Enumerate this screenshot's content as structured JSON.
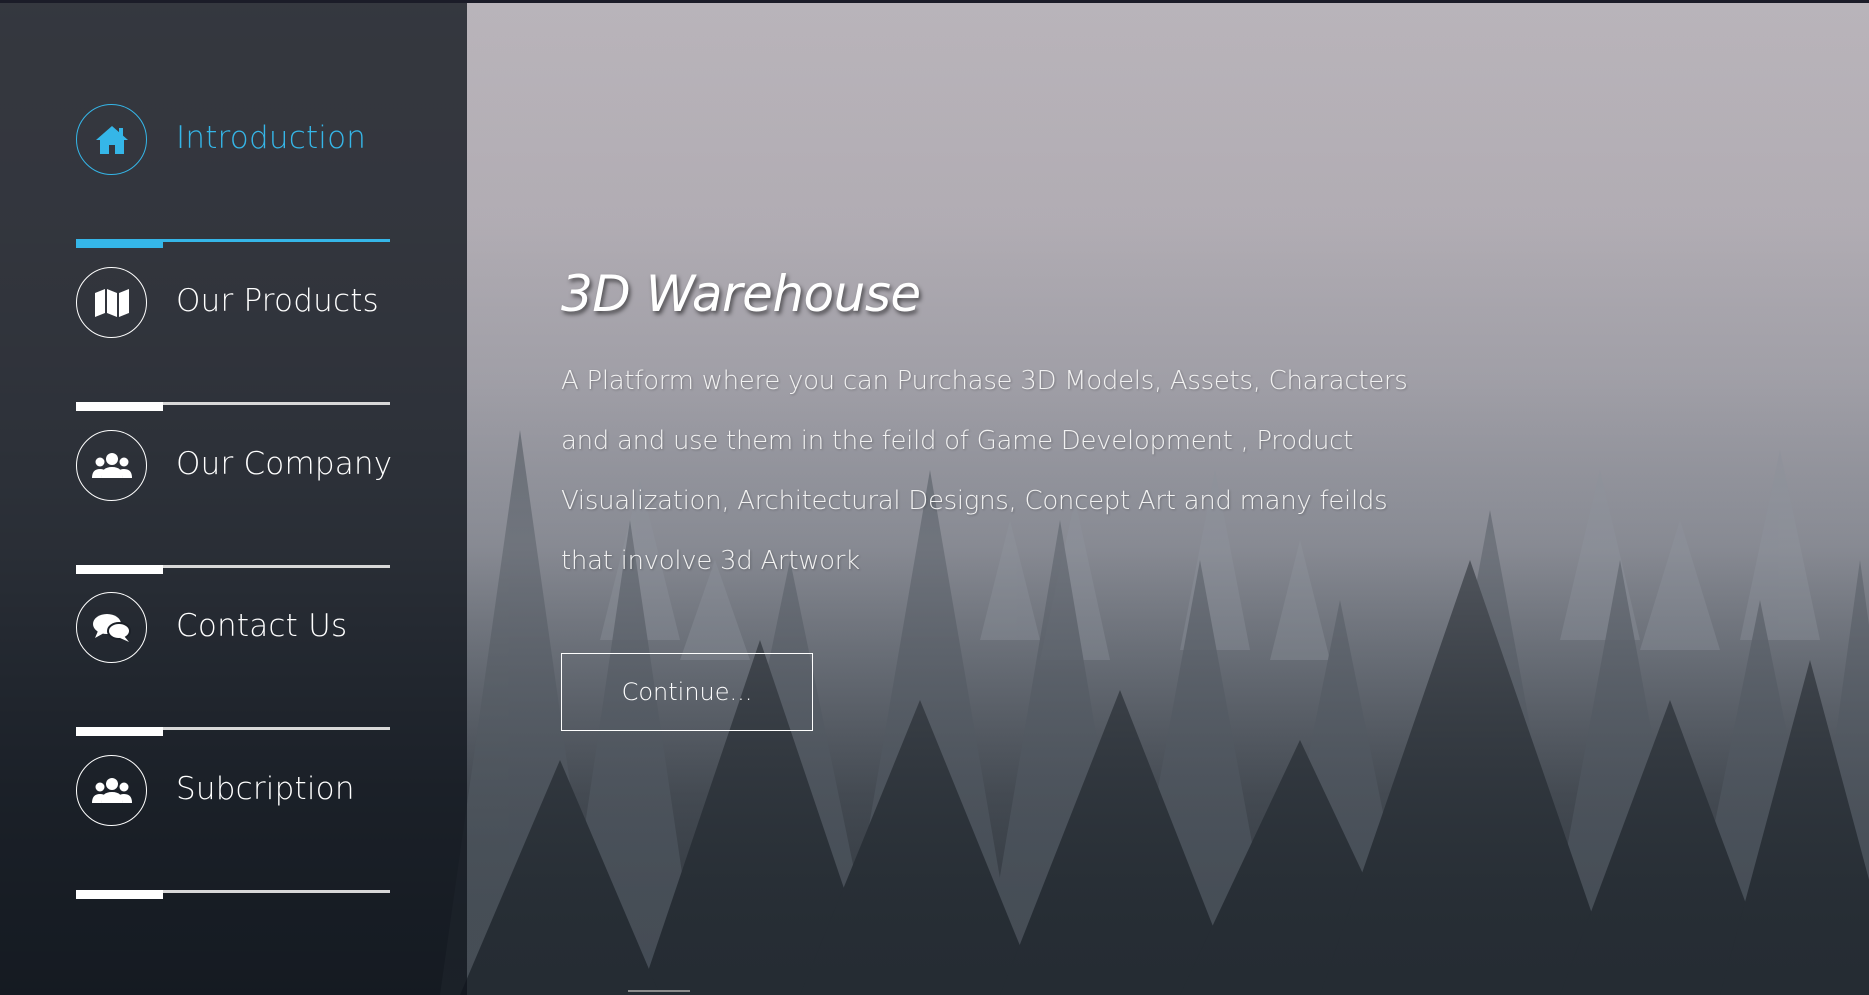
{
  "colors": {
    "accent": "#35b6e8",
    "sidebar_bg": "rgba(16,20,28,0.78)",
    "text": "#ffffff"
  },
  "sidebar": {
    "items": [
      {
        "label": "Introduction",
        "icon": "home-icon",
        "active": true
      },
      {
        "label": "Our Products",
        "icon": "map-icon",
        "active": false
      },
      {
        "label": "Our Company",
        "icon": "users-icon",
        "active": false
      },
      {
        "label": "Contact Us",
        "icon": "chat-bubbles-icon",
        "active": false
      },
      {
        "label": "Subcription",
        "icon": "users-icon",
        "active": false
      }
    ]
  },
  "main": {
    "title": "3D Warehouse",
    "description": "A Platform where you can Purchase 3D Models, Assets, Characters and and use them in the feild of Game Development , Product Visualization, Architectural Designs, Concept Art and many feilds that involve 3d Artwork",
    "continue_label": "Continue..."
  }
}
